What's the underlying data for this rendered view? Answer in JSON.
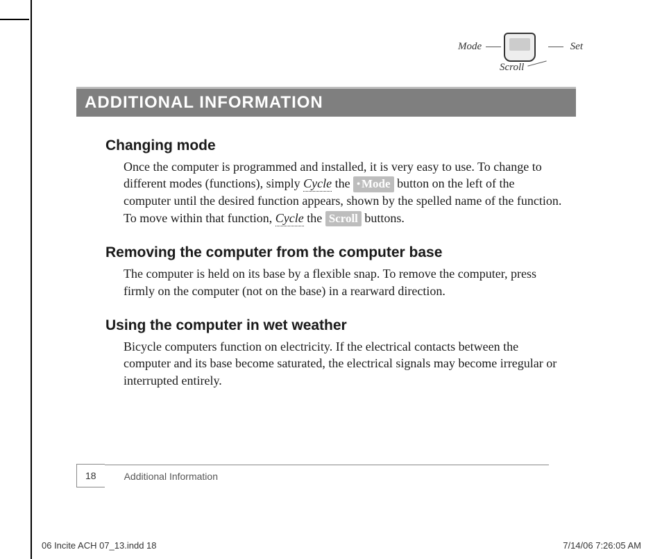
{
  "device": {
    "mode_label": "Mode",
    "set_label": "Set",
    "scroll_label": "Scroll"
  },
  "header": "ADDITIONAL INFORMATION",
  "sections": {
    "s1": {
      "heading": "Changing mode",
      "p_a": "Once the computer is programmed and installed, it is very easy to use. To change to different modes (functions), simply ",
      "cycle1": "Cycle",
      "p_b": " the ",
      "btn_mode": "Mode",
      "p_c": " button on the left of the computer until the desired function appears, shown by the spelled name of the function. To move within that function, ",
      "cycle2": "Cycle",
      "p_d": " the ",
      "btn_scroll": "Scroll",
      "p_e": " buttons."
    },
    "s2": {
      "heading": "Removing the computer from the computer base",
      "p": "The computer is held on its base by a flexible snap. To remove the computer, press firmly on the computer (not on the base) in a rearward direction."
    },
    "s3": {
      "heading": "Using the computer in wet weather",
      "p": "Bicycle computers function on electricity. If the electrical contacts between the computer and its base become saturated, the electrical signals may become irregular or interrupted entirely."
    }
  },
  "footer": {
    "page_num": "18",
    "label": "Additional Information"
  },
  "meta": {
    "left": "06 Incite ACH 07_13.indd   18",
    "right": "7/14/06   7:26:05 AM"
  }
}
